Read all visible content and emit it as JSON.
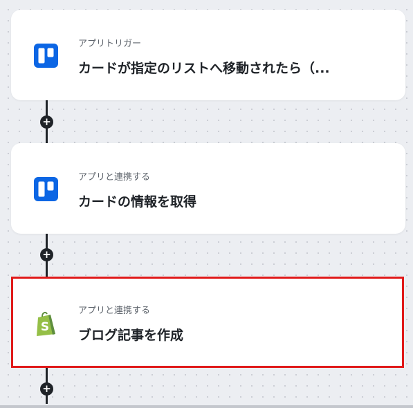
{
  "workflow": {
    "steps": [
      {
        "type": "trigger",
        "app_icon": "trello-icon",
        "caption": "アプリトリガー",
        "title": "カードが指定のリストへ移動されたら（..."
      },
      {
        "type": "action",
        "app_icon": "trello-icon",
        "caption": "アプリと連携する",
        "title": "カードの情報を取得"
      },
      {
        "type": "action",
        "app_icon": "shopify-icon",
        "caption": "アプリと連携する",
        "title": "ブログ記事を作成",
        "selected": true
      }
    ],
    "add_step_symbol": "+"
  },
  "colors": {
    "trello_blue": "#0c66e4",
    "shopify_green": "#95bf47",
    "selection_red": "#e01a1a",
    "connector": "#1f2328"
  }
}
